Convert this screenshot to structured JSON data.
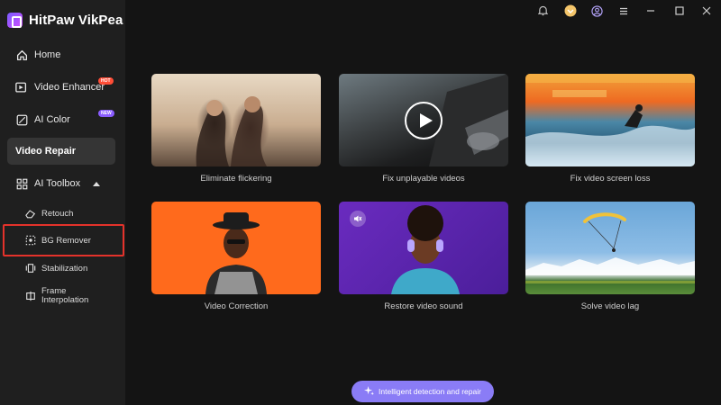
{
  "app": {
    "title": "HitPaw VikPea"
  },
  "sidebar": {
    "items": [
      {
        "label": "Home",
        "icon": "home-icon"
      },
      {
        "label": "Video Enhancer",
        "icon": "video-enhancer-icon",
        "badge": "HOT"
      },
      {
        "label": "AI Color",
        "icon": "ai-color-icon",
        "badge": "NEW"
      },
      {
        "label": "Video Repair",
        "icon": "",
        "active": true
      },
      {
        "label": "AI Toolbox",
        "icon": "toolbox-icon",
        "expanded": true
      }
    ],
    "subitems": [
      {
        "label": "Retouch",
        "icon": "eraser-icon"
      },
      {
        "label": "BG Remover",
        "icon": "bg-remover-icon",
        "highlighted": true
      },
      {
        "label": "Stabilization",
        "icon": "stabilization-icon"
      },
      {
        "label": "Frame Interpolation",
        "line1": "Frame",
        "line2": "Interpolation",
        "icon": "frame-interpolation-icon"
      }
    ]
  },
  "cards": [
    {
      "label": "Eliminate flickering"
    },
    {
      "label": "Fix unplayable videos"
    },
    {
      "label": "Fix video screen loss"
    },
    {
      "label": "Video Correction"
    },
    {
      "label": "Restore video sound"
    },
    {
      "label": "Solve video lag"
    }
  ],
  "cta": {
    "label": "Intelligent detection and repair"
  },
  "colors": {
    "accent": "#8a7cf6",
    "highlight_border": "#e4322b",
    "sidebar_bg": "#1f1f1f",
    "main_bg": "#141414"
  }
}
